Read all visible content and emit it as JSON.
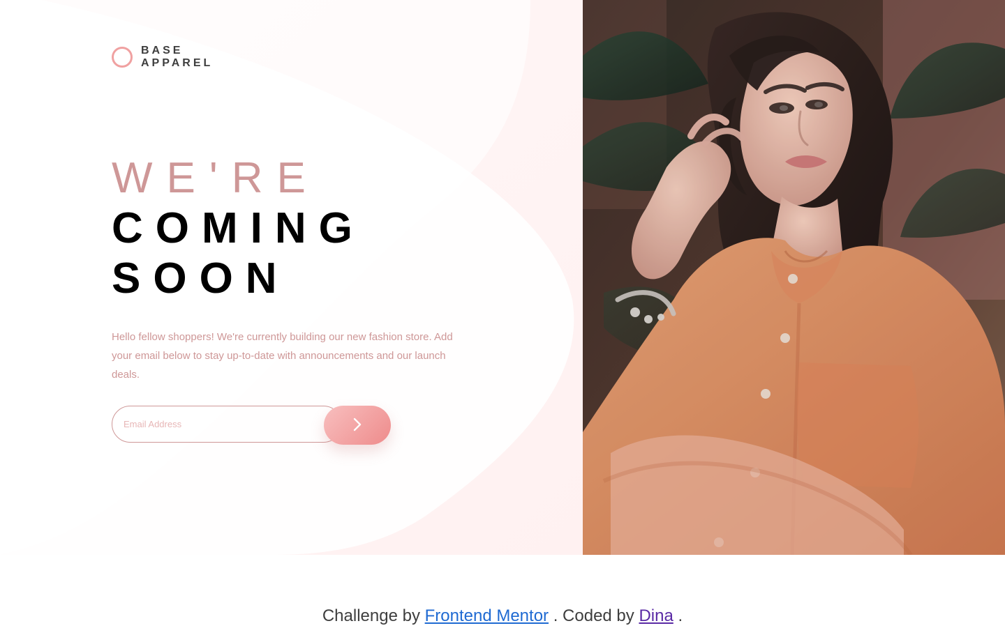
{
  "brand": {
    "logo_line1": "BASE",
    "logo_line2": "APPAREL",
    "accent_color": "#ce9797",
    "button_gradient": [
      "#f8bfbf",
      "#ee8b8b"
    ]
  },
  "hero": {
    "headline_light": "WE'RE",
    "headline_dark_line1": "COMING",
    "headline_dark_line2": "SOON",
    "description": "Hello fellow shoppers! We're currently building our new fashion store. Add your email below to stay up-to-date with announcements and our launch deals."
  },
  "form": {
    "email_placeholder": "Email Address",
    "email_value": "",
    "submit_icon": "chevron-right-icon"
  },
  "attribution": {
    "prefix": "Challenge by ",
    "frontend_mentor_label": "Frontend Mentor",
    "middle": ". Coded by ",
    "author_label": "Dina",
    "suffix": "."
  }
}
